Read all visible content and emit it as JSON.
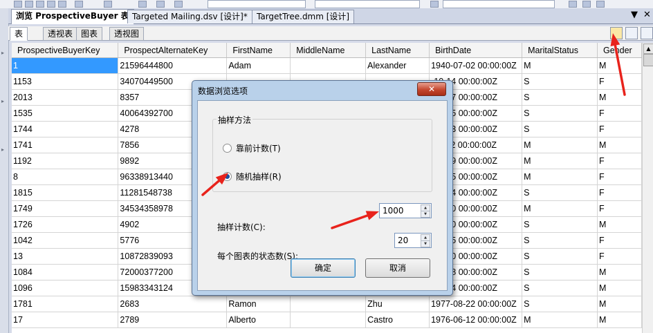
{
  "doc_tabs": [
    {
      "label": "浏览 ProspectiveBuyer 表",
      "active": true
    },
    {
      "label": "Targeted Mailing.dsv [设计]*",
      "active": false
    },
    {
      "label": "TargetTree.dmm [设计]",
      "active": false
    }
  ],
  "doc_tab_controls": {
    "dropdown": "▼",
    "close": "✕"
  },
  "sub_tabs": [
    "表",
    "透视表",
    "图表",
    "透视图"
  ],
  "grid": {
    "columns": [
      "ProspectiveBuyerKey",
      "ProspectAlternateKey",
      "FirstName",
      "MiddleName",
      "LastName",
      "BirthDate",
      "MaritalStatus",
      "Gender"
    ],
    "rows": [
      [
        "1",
        "21596444800",
        "Adam",
        "",
        "Alexander",
        "1940-07-02 00:00:00Z",
        "M",
        "M"
      ],
      [
        "1153",
        "34070449500",
        "",
        "",
        "",
        "-10-14 00:00:00Z",
        "S",
        "F"
      ],
      [
        "2013",
        "8357",
        "",
        "",
        "",
        "-07-17 00:00:00Z",
        "S",
        "M"
      ],
      [
        "1535",
        "40064392700",
        "",
        "",
        "",
        "-01-15 00:00:00Z",
        "S",
        "F"
      ],
      [
        "1744",
        "4278",
        "",
        "",
        "",
        "-07-13 00:00:00Z",
        "S",
        "F"
      ],
      [
        "1741",
        "7856",
        "",
        "",
        "",
        "-11-22 00:00:00Z",
        "M",
        "M"
      ],
      [
        "1192",
        "9892",
        "",
        "",
        "",
        "-06-19 00:00:00Z",
        "M",
        "F"
      ],
      [
        "8",
        "96338913440",
        "",
        "",
        "",
        "-07-15 00:00:00Z",
        "M",
        "F"
      ],
      [
        "1815",
        "11281548738",
        "",
        "",
        "",
        "-07-04 00:00:00Z",
        "S",
        "F"
      ],
      [
        "1749",
        "34534358978",
        "",
        "",
        "",
        "-06-20 00:00:00Z",
        "M",
        "F"
      ],
      [
        "1726",
        "4902",
        "",
        "",
        "",
        "-10-20 00:00:00Z",
        "S",
        "M"
      ],
      [
        "1042",
        "5776",
        "",
        "",
        "",
        "-08-15 00:00:00Z",
        "S",
        "F"
      ],
      [
        "13",
        "10872839093",
        "",
        "",
        "",
        "-10-20 00:00:00Z",
        "S",
        "F"
      ],
      [
        "1084",
        "72000377200",
        "",
        "",
        "",
        "-08-08 00:00:00Z",
        "S",
        "M"
      ],
      [
        "1096",
        "15983343124",
        "",
        "",
        "",
        "-10-04 00:00:00Z",
        "S",
        "M"
      ],
      [
        "1781",
        "2683",
        "Ramon",
        "",
        "Zhu",
        "1977-08-22 00:00:00Z",
        "S",
        "M"
      ],
      [
        "17",
        "2789",
        "Alberto",
        "",
        "Castro",
        "1976-06-12 00:00:00Z",
        "M",
        "M"
      ]
    ]
  },
  "dialog": {
    "title": "数据浏览选项",
    "close": "✕",
    "group_label": "抽样方法",
    "option_top": "靠前计数(T)",
    "option_random": "随机抽样(R)",
    "selected": "random",
    "sample_count_label": "抽样计数(C):",
    "sample_count_value": "1000",
    "states_label": "每个图表的状态数(S):",
    "states_value": "20",
    "ok": "确定",
    "cancel": "取消"
  },
  "annotation_color": "#e8231c"
}
